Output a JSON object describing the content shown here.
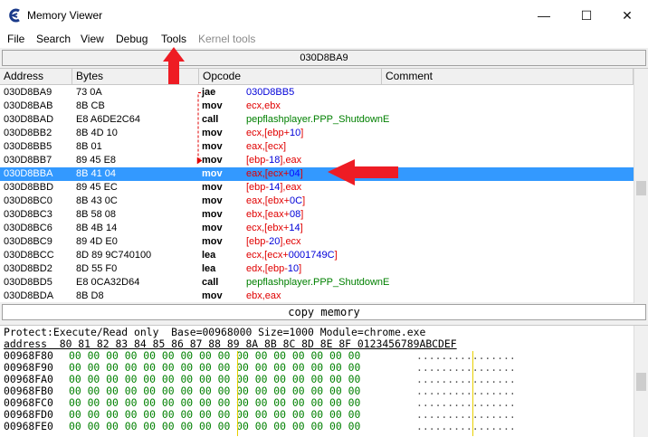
{
  "window": {
    "title": "Memory Viewer",
    "minimize": "—",
    "maximize": "☐",
    "close": "✕"
  },
  "menu": [
    "File",
    "Search",
    "View",
    "Debug",
    "Tools",
    "Kernel tools"
  ],
  "address_bar": "030D8BA9",
  "columns": {
    "address": "Address",
    "bytes": "Bytes",
    "opcode": "Opcode",
    "comment": "Comment"
  },
  "disasm": [
    {
      "addr": "030D8BA9",
      "bytes": "73 0A",
      "op": "jae",
      "args": [
        [
          "imm",
          "030D8BB5"
        ]
      ]
    },
    {
      "addr": "030D8BAB",
      "bytes": "8B CB",
      "op": "mov",
      "args": [
        [
          "reg",
          "ecx,ebx"
        ]
      ]
    },
    {
      "addr": "030D8BAD",
      "bytes": "E8 A6DE2C64",
      "op": "call",
      "args": [
        [
          "sym",
          "pepflashplayer.PPP_ShutdownE"
        ]
      ]
    },
    {
      "addr": "030D8BB2",
      "bytes": "8B 4D 10",
      "op": "mov",
      "args": [
        [
          "reg",
          "ecx,[ebp+"
        ],
        [
          "imm",
          "10"
        ],
        [
          "reg",
          "]"
        ]
      ]
    },
    {
      "addr": "030D8BB5",
      "bytes": "8B 01",
      "op": "mov",
      "args": [
        [
          "reg",
          "eax,[ecx]"
        ]
      ]
    },
    {
      "addr": "030D8BB7",
      "bytes": "89 45 E8",
      "op": "mov",
      "args": [
        [
          "reg",
          "[ebp-"
        ],
        [
          "imm",
          "18"
        ],
        [
          "reg",
          "],eax"
        ]
      ]
    },
    {
      "addr": "030D8BBA",
      "bytes": "8B 41 04",
      "op": "mov",
      "args": [
        [
          "reg",
          "eax,[ecx+"
        ],
        [
          "imm",
          "04"
        ],
        [
          "reg",
          "]"
        ]
      ]
    },
    {
      "addr": "030D8BBD",
      "bytes": "89 45 EC",
      "op": "mov",
      "args": [
        [
          "reg",
          "[ebp-"
        ],
        [
          "imm",
          "14"
        ],
        [
          "reg",
          "],eax"
        ]
      ]
    },
    {
      "addr": "030D8BC0",
      "bytes": "8B 43 0C",
      "op": "mov",
      "args": [
        [
          "reg",
          "eax,[ebx+"
        ],
        [
          "imm",
          "0C"
        ],
        [
          "reg",
          "]"
        ]
      ]
    },
    {
      "addr": "030D8BC3",
      "bytes": "8B 58 08",
      "op": "mov",
      "args": [
        [
          "reg",
          "ebx,[eax+"
        ],
        [
          "imm",
          "08"
        ],
        [
          "reg",
          "]"
        ]
      ]
    },
    {
      "addr": "030D8BC6",
      "bytes": "8B 4B 14",
      "op": "mov",
      "args": [
        [
          "reg",
          "ecx,[ebx+"
        ],
        [
          "imm",
          "14"
        ],
        [
          "reg",
          "]"
        ]
      ]
    },
    {
      "addr": "030D8BC9",
      "bytes": "89 4D E0",
      "op": "mov",
      "args": [
        [
          "reg",
          "[ebp-"
        ],
        [
          "imm",
          "20"
        ],
        [
          "reg",
          "],ecx"
        ]
      ]
    },
    {
      "addr": "030D8BCC",
      "bytes": "8D 89 9C740100",
      "op": "lea",
      "args": [
        [
          "reg",
          "ecx,[ecx+"
        ],
        [
          "imm",
          "0001749C"
        ],
        [
          "reg",
          "]"
        ]
      ]
    },
    {
      "addr": "030D8BD2",
      "bytes": "8D 55 F0",
      "op": "lea",
      "args": [
        [
          "reg",
          "edx,[ebp-"
        ],
        [
          "imm",
          "10"
        ],
        [
          "reg",
          "]"
        ]
      ]
    },
    {
      "addr": "030D8BD5",
      "bytes": "E8 0CA32D64",
      "op": "call",
      "args": [
        [
          "sym",
          "pepflashplayer.PPP_ShutdownE"
        ]
      ]
    },
    {
      "addr": "030D8BDA",
      "bytes": "8B D8",
      "op": "mov",
      "args": [
        [
          "reg",
          "ebx,eax"
        ]
      ]
    }
  ],
  "selected_index": 6,
  "copy_bar": "copy memory",
  "hex": {
    "protect_line": "Protect:Execute/Read only  Base=00968000 Size=1000 Module=chrome.exe",
    "header_line": "address  80 81 82 83 84 85 86 87 88 89 8A 8B 8C 8D 8E 8F 0123456789ABCDEF",
    "rows": [
      {
        "addr": "00968F80",
        "bytes": "00 00 00 00 00 00 00 00 00 00 00 00 00 00 00 00",
        "ascii": "................"
      },
      {
        "addr": "00968F90",
        "bytes": "00 00 00 00 00 00 00 00 00 00 00 00 00 00 00 00",
        "ascii": "................"
      },
      {
        "addr": "00968FA0",
        "bytes": "00 00 00 00 00 00 00 00 00 00 00 00 00 00 00 00",
        "ascii": "................"
      },
      {
        "addr": "00968FB0",
        "bytes": "00 00 00 00 00 00 00 00 00 00 00 00 00 00 00 00",
        "ascii": "................"
      },
      {
        "addr": "00968FC0",
        "bytes": "00 00 00 00 00 00 00 00 00 00 00 00 00 00 00 00",
        "ascii": "................"
      },
      {
        "addr": "00968FD0",
        "bytes": "00 00 00 00 00 00 00 00 00 00 00 00 00 00 00 00",
        "ascii": "................"
      },
      {
        "addr": "00968FE0",
        "bytes": "00 00 00 00 00 00 00 00 00 00 00 00 00 00 00 00",
        "ascii": "................"
      }
    ]
  },
  "colors": {
    "selection": "#3399ff",
    "register": "#e00000",
    "immediate": "#0000d8",
    "symbol": "#008000",
    "annotation_arrow": "#ee1c24"
  }
}
